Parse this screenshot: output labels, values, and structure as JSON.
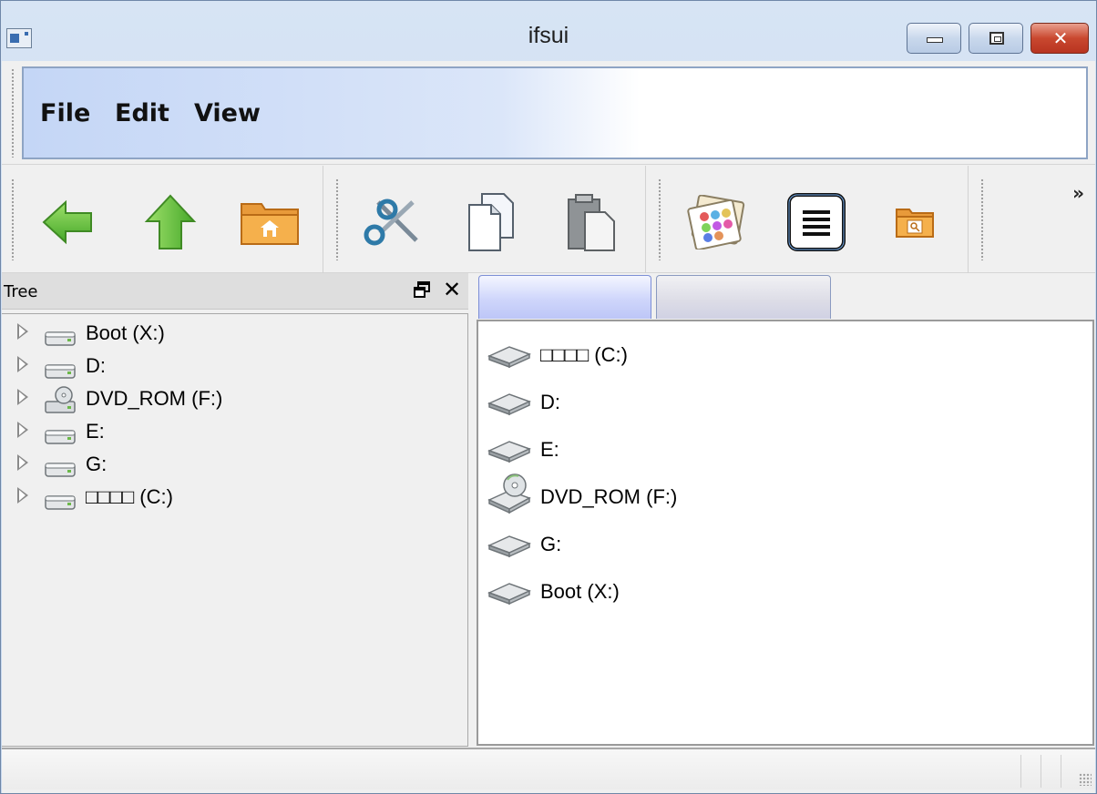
{
  "window": {
    "title": "ifsui"
  },
  "caption_buttons": {
    "minimize": "minimize",
    "maximize": "maximize",
    "close": "close"
  },
  "menu": {
    "items": [
      "File",
      "Edit",
      "View"
    ]
  },
  "toolbar": {
    "groups": [
      [
        "back-arrow-icon",
        "up-arrow-icon",
        "home-folder-icon"
      ],
      [
        "cut-icon",
        "copy-icon",
        "paste-icon"
      ],
      [
        "view-icons-icon",
        "view-list-icon",
        "search-folder-icon"
      ]
    ],
    "overflow": "»"
  },
  "dock": {
    "title": "Tree"
  },
  "tree": {
    "items": [
      {
        "label": "Boot (X:)",
        "icon": "drive-icon"
      },
      {
        "label": "D:",
        "icon": "drive-icon"
      },
      {
        "label": "DVD_ROM (F:)",
        "icon": "dvd-drive-icon"
      },
      {
        "label": "E:",
        "icon": "drive-icon"
      },
      {
        "label": "G:",
        "icon": "drive-icon"
      },
      {
        "label": "□□□□ (C:)",
        "icon": "drive-icon"
      }
    ]
  },
  "tabs": [
    {
      "label": ""
    },
    {
      "label": ""
    }
  ],
  "list": {
    "items": [
      {
        "label": "□□□□ (C:)",
        "icon": "drive-icon"
      },
      {
        "label": "D:",
        "icon": "drive-icon"
      },
      {
        "label": "E:",
        "icon": "drive-icon"
      },
      {
        "label": "DVD_ROM (F:)",
        "icon": "dvd-drive-icon"
      },
      {
        "label": "G:",
        "icon": "drive-icon"
      },
      {
        "label": "Boot (X:)",
        "icon": "drive-icon"
      }
    ]
  },
  "colors": {
    "accent": "#7d8fd6",
    "menu_gradient": "#c4d6f6",
    "close_button": "#c9482f"
  }
}
